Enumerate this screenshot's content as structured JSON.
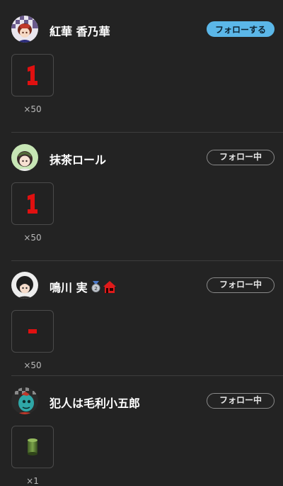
{
  "entries": [
    {
      "name": "紅華 香乃華",
      "follow_label": "フォローする",
      "follow_state": "not-following",
      "gift_icon": "red-number-one-icon",
      "gift_count": "×50"
    },
    {
      "name": "抹茶ロール",
      "follow_label": "フォロー中",
      "follow_state": "following",
      "gift_icon": "red-number-one-icon",
      "gift_count": "×50"
    },
    {
      "name": "鳴川 実",
      "follow_label": "フォロー中",
      "follow_state": "following",
      "badges": [
        "silver-medal-2-icon",
        "red-house-icon"
      ],
      "gift_icon": "red-dash-icon",
      "gift_count": "×50"
    },
    {
      "name": "犯人は毛利小五郎",
      "follow_label": "フォロー中",
      "follow_state": "following",
      "gift_icon": "green-cylinder-icon",
      "gift_count": "×1"
    }
  ],
  "colors": {
    "background": "#232323",
    "follow_primary": "#5bb7e8",
    "gift_red": "#e01010"
  }
}
